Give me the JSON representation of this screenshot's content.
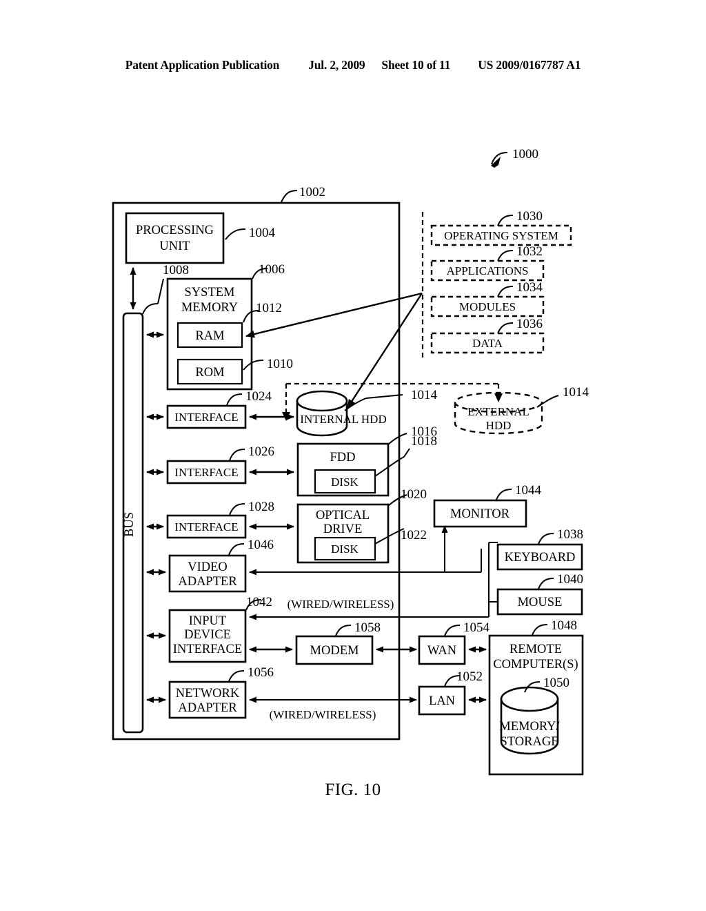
{
  "header": {
    "publication": "Patent Application Publication",
    "date": "Jul. 2, 2009",
    "sheet": "Sheet 10 of 11",
    "patent_number": "US 2009/0167787 A1"
  },
  "figure": {
    "caption": "FIG. 10",
    "overall_ref": "1000"
  },
  "diagram": {
    "computer_enclosure_ref": "1002",
    "bus_label": "BUS",
    "bus_ref": "1008",
    "blocks": {
      "processing_unit": {
        "label_line1": "PROCESSING",
        "label_line2": "UNIT",
        "ref": "1004"
      },
      "system_memory": {
        "label_line1": "SYSTEM",
        "label_line2": "MEMORY",
        "ref": "1006"
      },
      "ram": {
        "label": "RAM",
        "ref": "1012"
      },
      "rom": {
        "label": "ROM",
        "ref": "1010"
      },
      "interface_hdd": {
        "label": "INTERFACE",
        "ref": "1024"
      },
      "interface_fdd": {
        "label": "INTERFACE",
        "ref": "1026"
      },
      "interface_optical": {
        "label": "INTERFACE",
        "ref": "1028"
      },
      "video_adapter": {
        "label_line1": "VIDEO",
        "label_line2": "ADAPTER",
        "ref": "1046"
      },
      "input_device_interface": {
        "label_line1": "INPUT",
        "label_line2": "DEVICE",
        "label_line3": "INTERFACE",
        "ref": "1042"
      },
      "network_adapter": {
        "label_line1": "NETWORK",
        "label_line2": "ADAPTER",
        "ref": "1056"
      },
      "internal_hdd": {
        "label": "INTERNAL HDD",
        "ref": "1014"
      },
      "external_hdd": {
        "label_line1": "EXTERNAL",
        "label_line2": "HDD",
        "ref": "1014"
      },
      "fdd": {
        "label": "FDD",
        "ref": "1016"
      },
      "fdd_disk": {
        "label": "DISK",
        "ref": "1018"
      },
      "optical_drive": {
        "label_line1": "OPTICAL",
        "label_line2": "DRIVE",
        "ref": "1020"
      },
      "optical_disk": {
        "label": "DISK",
        "ref": "1022"
      },
      "monitor": {
        "label": "MONITOR",
        "ref": "1044"
      },
      "keyboard": {
        "label": "KEYBOARD",
        "ref": "1038"
      },
      "mouse": {
        "label": "MOUSE",
        "ref": "1040"
      },
      "modem": {
        "label": "MODEM",
        "ref": "1058"
      },
      "wan": {
        "label": "WAN",
        "ref": "1054"
      },
      "lan": {
        "label": "LAN",
        "ref": "1052"
      },
      "remote_computers": {
        "label_line1": "REMOTE",
        "label_line2": "COMPUTER(S)",
        "ref": "1048"
      },
      "memory_storage": {
        "label_line1": "MEMORY/",
        "label_line2": "STORAGE",
        "ref": "1050"
      }
    },
    "software_blocks": [
      {
        "label": "OPERATING SYSTEM",
        "ref": "1030"
      },
      {
        "label": "APPLICATIONS",
        "ref": "1032"
      },
      {
        "label": "MODULES",
        "ref": "1034"
      },
      {
        "label": "DATA",
        "ref": "1036"
      }
    ],
    "annotations": {
      "wired_wireless_top": "(WIRED/WIRELESS)",
      "wired_wireless_bottom": "(WIRED/WIRELESS)"
    }
  }
}
